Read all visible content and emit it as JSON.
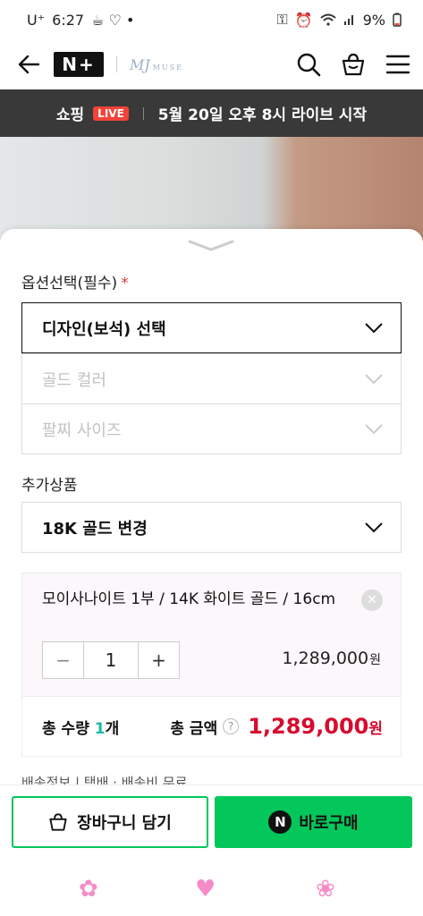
{
  "status_bar": {
    "carrier": "U⁺",
    "time": "6:27",
    "battery": "9%",
    "icons": [
      "key-icon",
      "alarm-icon",
      "wifi-icon",
      "signal-icon",
      "battery-icon"
    ]
  },
  "header": {
    "logo": "N+",
    "brand": "MJ",
    "brand_sub": "MUSE",
    "icons": [
      "back-arrow-icon",
      "search-icon",
      "shopping-bag-icon",
      "menu-icon"
    ]
  },
  "banner": {
    "prefix": "쇼핑",
    "badge": "LIVE",
    "text": "5월 20일 오후 8시 라이브 시작"
  },
  "options": {
    "label": "옵션선택(필수)",
    "required_mark": "*",
    "design_select": "디자인(보석) 선택",
    "gold_select": "골드 컬러",
    "size_select": "팔찌 사이즈"
  },
  "additional": {
    "label": "추가상품",
    "select": "18K 골드 변경"
  },
  "selected_item": {
    "name": "모이사나이트 1부 / 14K 화이트 골드 / 16cm",
    "quantity": "1",
    "minus": "−",
    "plus": "+",
    "price": "1,289,000",
    "currency": "원"
  },
  "totals": {
    "qty_prefix": "총 수량 ",
    "qty_value": "1",
    "qty_suffix": "개",
    "amount_label": "총 금액",
    "help": "?",
    "amount": "1,289,000",
    "currency": "원"
  },
  "shipping": {
    "text": "배송정보  |  택배 · 배송비 무료"
  },
  "actions": {
    "cart_label": "장바구니 담기",
    "buy_label": "바로구매",
    "buy_badge": "N"
  },
  "colors": {
    "accent_green": "#03c75a",
    "price_red": "#d60c2e",
    "banner_bg": "#393939",
    "live_red": "#f2433a"
  }
}
